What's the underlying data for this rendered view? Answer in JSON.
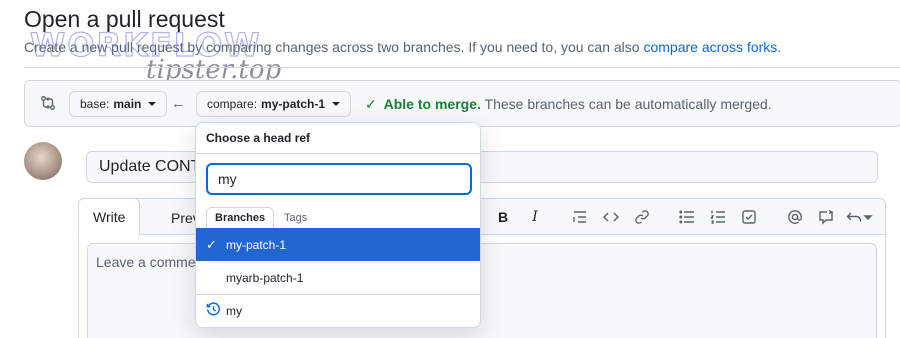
{
  "header": {
    "title": "Open a pull request",
    "subtitle": "Create a new pull request by comparing changes across two branches. If you need to, you can also ",
    "subtitle_link": "compare across forks."
  },
  "watermark": {
    "main": "WORKFLOW",
    "sub": "tipster.top"
  },
  "compare_bar": {
    "base_label": "base:",
    "base_value": "main",
    "compare_label": "compare:",
    "compare_value": "my-patch-1",
    "merge_ok": "Able to merge.",
    "merge_text": "These branches can be automatically merged."
  },
  "pr_form": {
    "title_value": "Update CONT",
    "tabs": [
      "Write",
      "Prev"
    ],
    "body_placeholder": "Leave a commen"
  },
  "toolbar": {
    "tools": [
      "bold-icon",
      "italic-icon",
      "heading-list-icon",
      "code-icon",
      "link-icon",
      "bullet-list-icon",
      "numbered-list-icon",
      "task-list-icon",
      "mention-icon",
      "reference-icon",
      "undo-icon"
    ],
    "bold": "B",
    "italic": "I"
  },
  "dropdown": {
    "title": "Choose a head ref",
    "filter_value": "my",
    "tabs": [
      "Branches",
      "Tags"
    ],
    "items": [
      {
        "label": "my-patch-1",
        "selected": true
      },
      {
        "label": "myarb-patch-1",
        "selected": false
      }
    ],
    "recent": "my"
  },
  "colors": {
    "accent": "#0969da",
    "selected_bg": "#2266d3",
    "success": "#1a7f37",
    "border": "#d1d9e0"
  }
}
